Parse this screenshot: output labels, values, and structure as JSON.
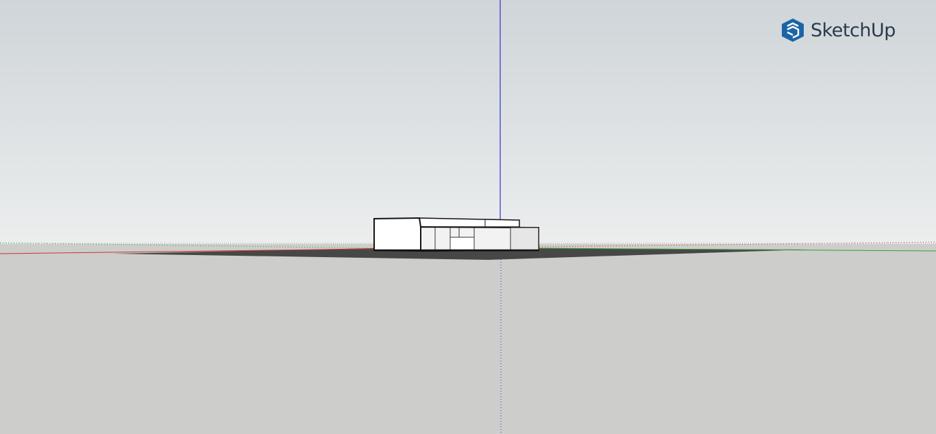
{
  "app": {
    "brand_name": "SketchUp",
    "brand_color": "#1b65a6",
    "brand_text_color": "#2b3a4a"
  },
  "viewport": {
    "sky_color": "#dde1e3",
    "ground_color": "#cdcdcb",
    "axis_colors": {
      "red": "#d03030",
      "green": "#30b030",
      "blue": "#3030d0"
    }
  },
  "icons": {
    "brand": "sketchup-logo-icon"
  }
}
